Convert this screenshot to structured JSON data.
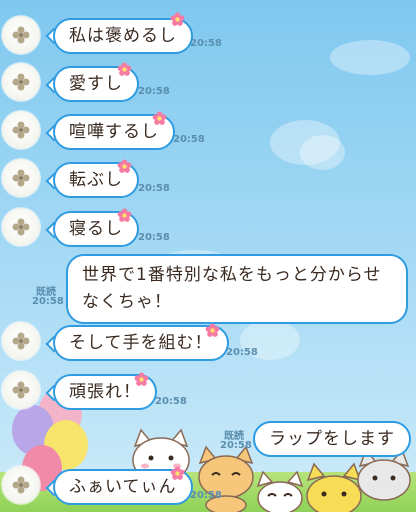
{
  "messages": [
    {
      "side": "left",
      "text": "私は褒めるし",
      "time": "20:58"
    },
    {
      "side": "left",
      "text": "愛すし",
      "time": "20:58"
    },
    {
      "side": "left",
      "text": "喧嘩するし",
      "time": "20:58"
    },
    {
      "side": "left",
      "text": "転ぶし",
      "time": "20:58"
    },
    {
      "side": "left",
      "text": "寝るし",
      "time": "20:58"
    },
    {
      "side": "right",
      "text": "世界で1番特別な私をもっと分からせなくちゃ！",
      "time": "20:58",
      "read": "既読"
    },
    {
      "side": "left",
      "text": "そして手を組む！",
      "time": "20:58"
    },
    {
      "side": "left",
      "text": "頑張れ！",
      "time": "20:58"
    },
    {
      "side": "right",
      "text": "ラップをします",
      "time": "20:58",
      "read": "既読"
    },
    {
      "side": "left",
      "text": "ふぁいてぃん",
      "time": "20:58"
    }
  ],
  "colors": {
    "bubble_border": "#2f9be0",
    "time_text": "#5b8fb0",
    "background": "#7fc8ef"
  },
  "icons": {
    "avatar": "clover-avatar-icon",
    "bubble_decoration": "pink-flower-icon"
  }
}
